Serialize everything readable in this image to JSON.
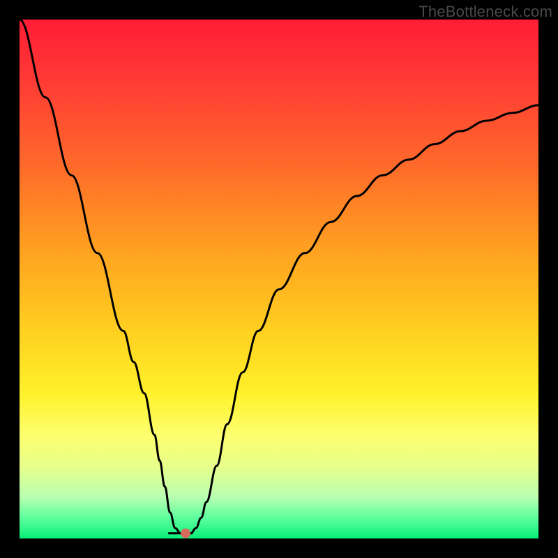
{
  "watermark": "TheBottleneck.com",
  "chart_data": {
    "type": "line",
    "title": "",
    "xlabel": "",
    "ylabel": "",
    "xlim": [
      0,
      100
    ],
    "ylim": [
      0,
      100
    ],
    "grid": false,
    "legend": false,
    "series": [
      {
        "name": "bottleneck-curve",
        "x": [
          0,
          5,
          10,
          15,
          20,
          22,
          24,
          26,
          27,
          28,
          29,
          30,
          31,
          32,
          33,
          34,
          35,
          36,
          38,
          40,
          43,
          46,
          50,
          55,
          60,
          65,
          70,
          75,
          80,
          85,
          90,
          95,
          100
        ],
        "y": [
          100,
          85,
          70,
          55,
          40,
          34,
          28,
          20,
          15,
          10,
          5,
          2,
          1,
          1,
          1,
          2,
          4,
          7,
          14,
          22,
          32,
          40,
          48,
          55,
          61,
          66,
          70,
          73,
          76,
          78.5,
          80.5,
          82,
          83.5
        ]
      }
    ],
    "marker": {
      "name": "optimal-point",
      "x": 32,
      "y": 1,
      "color": "#d46a5a",
      "radius_px": 7
    },
    "colors": {
      "curve": "#000000",
      "gradient_top": "#ff1d35",
      "gradient_mid": "#ffd020",
      "gradient_bottom": "#0af07a",
      "frame": "#000000"
    }
  }
}
